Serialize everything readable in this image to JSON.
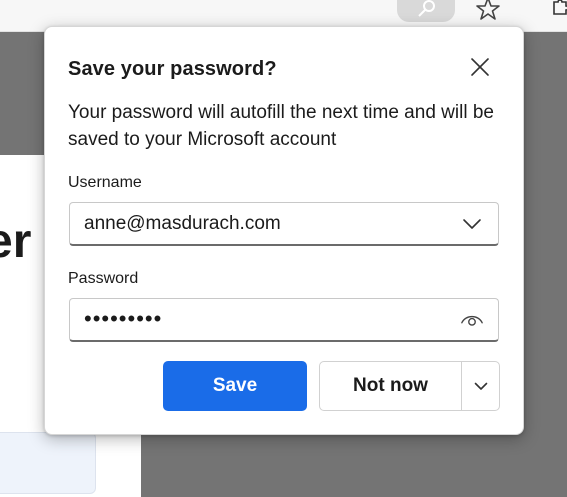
{
  "toolbar": {
    "icons": [
      "key-icon",
      "star-icon",
      "puzzle-icon"
    ]
  },
  "page": {
    "heading_fragment": "er"
  },
  "popup": {
    "title": "Save your password?",
    "description": "Your password will autofill the next time and will be saved to your Microsoft account",
    "username_label": "Username",
    "username_value": "anne@masdurach.com",
    "password_label": "Password",
    "password_mask": "•••••••••",
    "save_label": "Save",
    "not_now_label": "Not now"
  },
  "colors": {
    "accent": "#1a6ce8",
    "page_overlay": "#747474"
  }
}
